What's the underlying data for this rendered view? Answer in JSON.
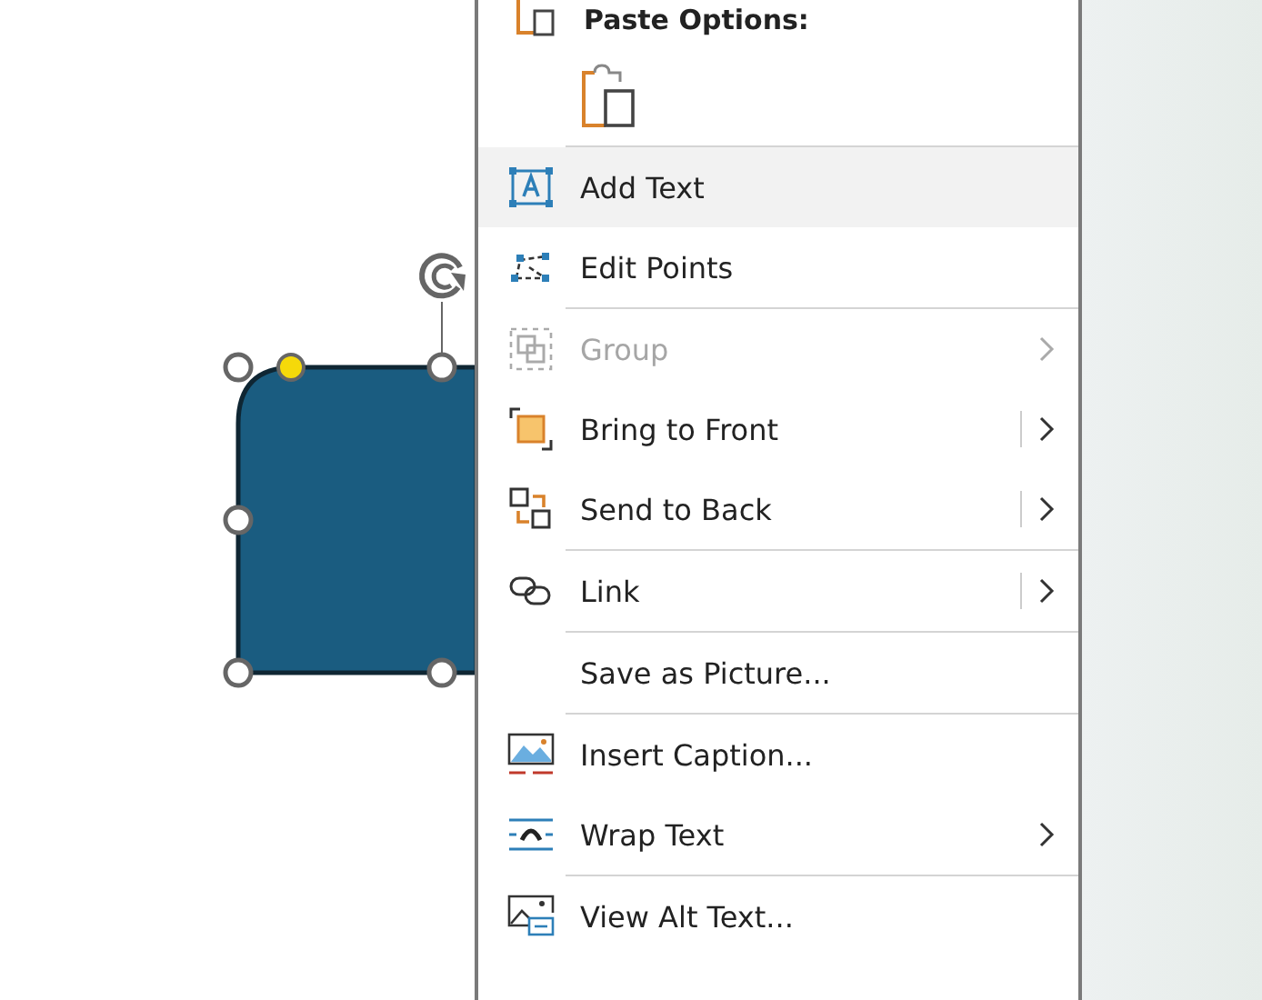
{
  "paste_options": {
    "title": "Paste Options:"
  },
  "menu_items": [
    {
      "label": "Add Text",
      "selected": true,
      "disabled": false,
      "has_submenu": false,
      "split": false,
      "separator_after": false
    },
    {
      "label": "Edit Points",
      "selected": false,
      "disabled": false,
      "has_submenu": false,
      "split": false,
      "separator_after": true
    },
    {
      "label": "Group",
      "selected": false,
      "disabled": true,
      "has_submenu": true,
      "split": false,
      "separator_after": false
    },
    {
      "label": "Bring to Front",
      "selected": false,
      "disabled": false,
      "has_submenu": true,
      "split": true,
      "separator_after": false
    },
    {
      "label": "Send to Back",
      "selected": false,
      "disabled": false,
      "has_submenu": true,
      "split": true,
      "separator_after": true
    },
    {
      "label": "Link",
      "selected": false,
      "disabled": false,
      "has_submenu": true,
      "split": true,
      "separator_after": true
    },
    {
      "label": "Save as Picture...",
      "selected": false,
      "disabled": false,
      "has_submenu": false,
      "split": false,
      "separator_after": true
    },
    {
      "label": "Insert Caption...",
      "selected": false,
      "disabled": false,
      "has_submenu": false,
      "split": false,
      "separator_after": false
    },
    {
      "label": "Wrap Text",
      "selected": false,
      "disabled": false,
      "has_submenu": true,
      "split": false,
      "separator_after": true
    },
    {
      "label": "View Alt Text...",
      "selected": false,
      "disabled": false,
      "has_submenu": false,
      "split": false,
      "separator_after": false
    }
  ]
}
